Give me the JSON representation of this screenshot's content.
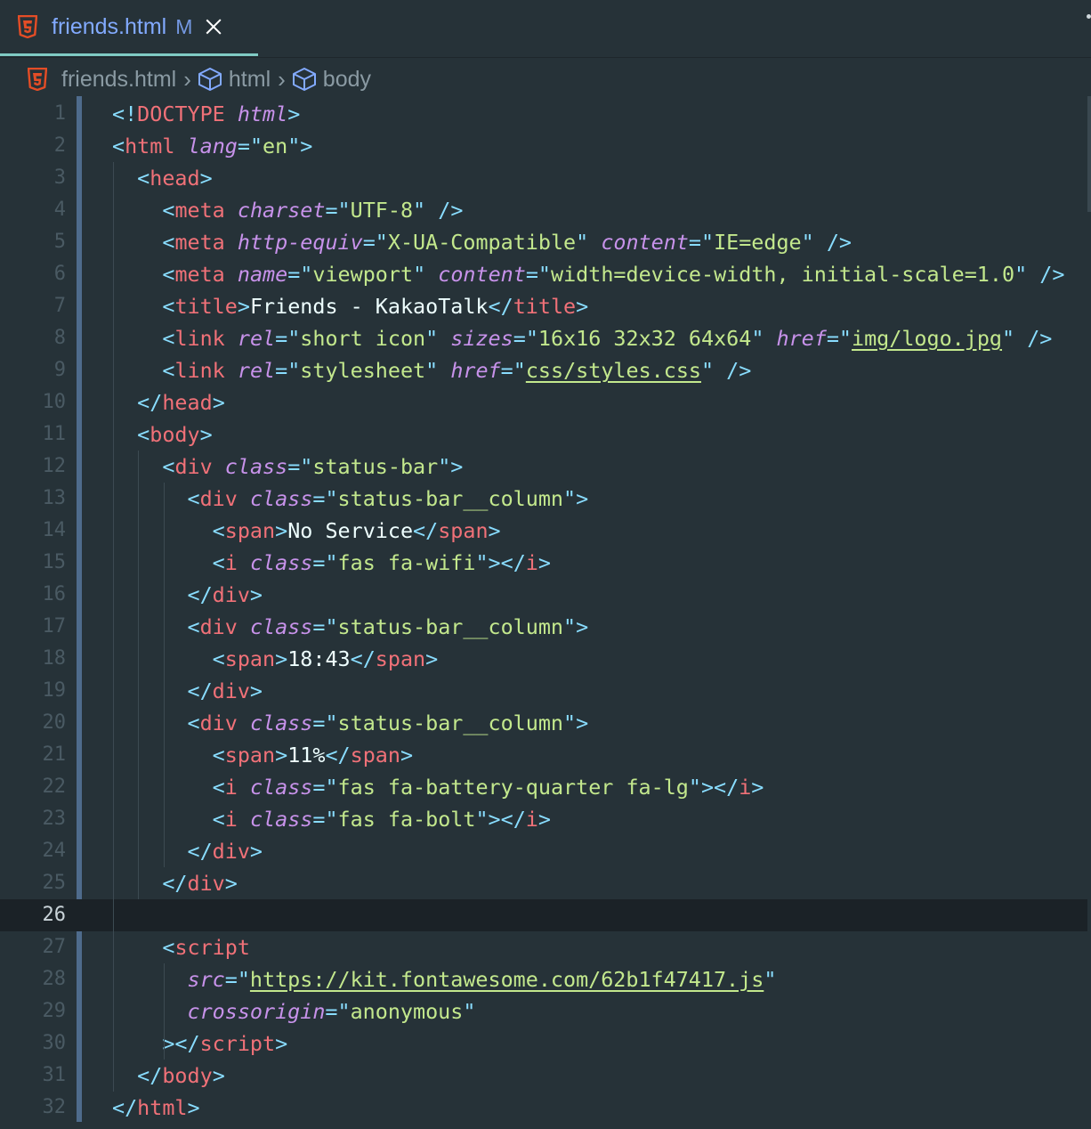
{
  "tab": {
    "file_name": "friends.html",
    "status_badge": "M",
    "icon": "html5-icon"
  },
  "breadcrumb": {
    "items": [
      {
        "label": "friends.html",
        "icon": "html5-icon"
      },
      {
        "label": "html",
        "icon": "cube-icon"
      },
      {
        "label": "body",
        "icon": "cube-icon"
      }
    ],
    "separator": "›"
  },
  "editor": {
    "active_line": 26,
    "lines": [
      {
        "n": "1",
        "tokens": [
          [
            "p",
            "<!"
          ],
          [
            "t",
            "DOCTYPE"
          ],
          [
            "tx",
            " "
          ],
          [
            "a",
            "html"
          ],
          [
            "p",
            ">"
          ]
        ]
      },
      {
        "n": "2",
        "tokens": [
          [
            "p",
            "<"
          ],
          [
            "t",
            "html"
          ],
          [
            "tx",
            " "
          ],
          [
            "a",
            "lang"
          ],
          [
            "p",
            "=\""
          ],
          [
            "s",
            "en"
          ],
          [
            "p",
            "\">"
          ]
        ]
      },
      {
        "n": "3",
        "tokens": [
          [
            "tx",
            "  "
          ],
          [
            "p",
            "<"
          ],
          [
            "t",
            "head"
          ],
          [
            "p",
            ">"
          ]
        ]
      },
      {
        "n": "4",
        "tokens": [
          [
            "tx",
            "    "
          ],
          [
            "p",
            "<"
          ],
          [
            "t",
            "meta"
          ],
          [
            "tx",
            " "
          ],
          [
            "a",
            "charset"
          ],
          [
            "p",
            "=\""
          ],
          [
            "s",
            "UTF-8"
          ],
          [
            "p",
            "\""
          ],
          [
            "tx",
            " "
          ],
          [
            "p",
            "/>"
          ]
        ]
      },
      {
        "n": "5",
        "tokens": [
          [
            "tx",
            "    "
          ],
          [
            "p",
            "<"
          ],
          [
            "t",
            "meta"
          ],
          [
            "tx",
            " "
          ],
          [
            "a",
            "http-equiv"
          ],
          [
            "p",
            "=\""
          ],
          [
            "s",
            "X-UA-Compatible"
          ],
          [
            "p",
            "\""
          ],
          [
            "tx",
            " "
          ],
          [
            "a",
            "content"
          ],
          [
            "p",
            "=\""
          ],
          [
            "s",
            "IE=edge"
          ],
          [
            "p",
            "\""
          ],
          [
            "tx",
            " "
          ],
          [
            "p",
            "/>"
          ]
        ]
      },
      {
        "n": "6",
        "tokens": [
          [
            "tx",
            "    "
          ],
          [
            "p",
            "<"
          ],
          [
            "t",
            "meta"
          ],
          [
            "tx",
            " "
          ],
          [
            "a",
            "name"
          ],
          [
            "p",
            "=\""
          ],
          [
            "s",
            "viewport"
          ],
          [
            "p",
            "\""
          ],
          [
            "tx",
            " "
          ],
          [
            "a",
            "content"
          ],
          [
            "p",
            "=\""
          ],
          [
            "s",
            "width=device-width, initial-scale=1.0"
          ],
          [
            "p",
            "\""
          ],
          [
            "tx",
            " "
          ],
          [
            "p",
            "/>"
          ]
        ]
      },
      {
        "n": "7",
        "tokens": [
          [
            "tx",
            "    "
          ],
          [
            "p",
            "<"
          ],
          [
            "t",
            "title"
          ],
          [
            "p",
            ">"
          ],
          [
            "tx",
            "Friends - KakaoTalk"
          ],
          [
            "p",
            "</"
          ],
          [
            "t",
            "title"
          ],
          [
            "p",
            ">"
          ]
        ]
      },
      {
        "n": "8",
        "tokens": [
          [
            "tx",
            "    "
          ],
          [
            "p",
            "<"
          ],
          [
            "t",
            "link"
          ],
          [
            "tx",
            " "
          ],
          [
            "a",
            "rel"
          ],
          [
            "p",
            "=\""
          ],
          [
            "s",
            "short icon"
          ],
          [
            "p",
            "\""
          ],
          [
            "tx",
            " "
          ],
          [
            "a",
            "sizes"
          ],
          [
            "p",
            "=\""
          ],
          [
            "s",
            "16x16 32x32 64x64"
          ],
          [
            "p",
            "\""
          ],
          [
            "tx",
            " "
          ],
          [
            "a",
            "href"
          ],
          [
            "p",
            "=\""
          ],
          [
            "su",
            "img/logo.jpg"
          ],
          [
            "p",
            "\""
          ],
          [
            "tx",
            " "
          ],
          [
            "p",
            "/>"
          ]
        ]
      },
      {
        "n": "9",
        "tokens": [
          [
            "tx",
            "    "
          ],
          [
            "p",
            "<"
          ],
          [
            "t",
            "link"
          ],
          [
            "tx",
            " "
          ],
          [
            "a",
            "rel"
          ],
          [
            "p",
            "=\""
          ],
          [
            "s",
            "stylesheet"
          ],
          [
            "p",
            "\""
          ],
          [
            "tx",
            " "
          ],
          [
            "a",
            "href"
          ],
          [
            "p",
            "=\""
          ],
          [
            "su",
            "css/styles.css"
          ],
          [
            "p",
            "\""
          ],
          [
            "tx",
            " "
          ],
          [
            "p",
            "/>"
          ]
        ]
      },
      {
        "n": "10",
        "tokens": [
          [
            "tx",
            "  "
          ],
          [
            "p",
            "</"
          ],
          [
            "t",
            "head"
          ],
          [
            "p",
            ">"
          ]
        ]
      },
      {
        "n": "11",
        "tokens": [
          [
            "tx",
            "  "
          ],
          [
            "p",
            "<"
          ],
          [
            "t",
            "body"
          ],
          [
            "p",
            ">"
          ]
        ]
      },
      {
        "n": "12",
        "tokens": [
          [
            "tx",
            "    "
          ],
          [
            "p",
            "<"
          ],
          [
            "t",
            "div"
          ],
          [
            "tx",
            " "
          ],
          [
            "a",
            "class"
          ],
          [
            "p",
            "=\""
          ],
          [
            "s",
            "status-bar"
          ],
          [
            "p",
            "\">"
          ]
        ]
      },
      {
        "n": "13",
        "tokens": [
          [
            "tx",
            "      "
          ],
          [
            "p",
            "<"
          ],
          [
            "t",
            "div"
          ],
          [
            "tx",
            " "
          ],
          [
            "a",
            "class"
          ],
          [
            "p",
            "=\""
          ],
          [
            "s",
            "status-bar__column"
          ],
          [
            "p",
            "\">"
          ]
        ]
      },
      {
        "n": "14",
        "tokens": [
          [
            "tx",
            "        "
          ],
          [
            "p",
            "<"
          ],
          [
            "t",
            "span"
          ],
          [
            "p",
            ">"
          ],
          [
            "tx",
            "No Service"
          ],
          [
            "p",
            "</"
          ],
          [
            "t",
            "span"
          ],
          [
            "p",
            ">"
          ]
        ]
      },
      {
        "n": "15",
        "tokens": [
          [
            "tx",
            "        "
          ],
          [
            "p",
            "<"
          ],
          [
            "t",
            "i"
          ],
          [
            "tx",
            " "
          ],
          [
            "a",
            "class"
          ],
          [
            "p",
            "=\""
          ],
          [
            "s",
            "fas fa-wifi"
          ],
          [
            "p",
            "\"></"
          ],
          [
            "t",
            "i"
          ],
          [
            "p",
            ">"
          ]
        ]
      },
      {
        "n": "16",
        "tokens": [
          [
            "tx",
            "      "
          ],
          [
            "p",
            "</"
          ],
          [
            "t",
            "div"
          ],
          [
            "p",
            ">"
          ]
        ]
      },
      {
        "n": "17",
        "tokens": [
          [
            "tx",
            "      "
          ],
          [
            "p",
            "<"
          ],
          [
            "t",
            "div"
          ],
          [
            "tx",
            " "
          ],
          [
            "a",
            "class"
          ],
          [
            "p",
            "=\""
          ],
          [
            "s",
            "status-bar__column"
          ],
          [
            "p",
            "\">"
          ]
        ]
      },
      {
        "n": "18",
        "tokens": [
          [
            "tx",
            "        "
          ],
          [
            "p",
            "<"
          ],
          [
            "t",
            "span"
          ],
          [
            "p",
            ">"
          ],
          [
            "tx",
            "18:43"
          ],
          [
            "p",
            "</"
          ],
          [
            "t",
            "span"
          ],
          [
            "p",
            ">"
          ]
        ]
      },
      {
        "n": "19",
        "tokens": [
          [
            "tx",
            "      "
          ],
          [
            "p",
            "</"
          ],
          [
            "t",
            "div"
          ],
          [
            "p",
            ">"
          ]
        ]
      },
      {
        "n": "20",
        "tokens": [
          [
            "tx",
            "      "
          ],
          [
            "p",
            "<"
          ],
          [
            "t",
            "div"
          ],
          [
            "tx",
            " "
          ],
          [
            "a",
            "class"
          ],
          [
            "p",
            "=\""
          ],
          [
            "s",
            "status-bar__column"
          ],
          [
            "p",
            "\">"
          ]
        ]
      },
      {
        "n": "21",
        "tokens": [
          [
            "tx",
            "        "
          ],
          [
            "p",
            "<"
          ],
          [
            "t",
            "span"
          ],
          [
            "p",
            ">"
          ],
          [
            "tx",
            "11%"
          ],
          [
            "p",
            "</"
          ],
          [
            "t",
            "span"
          ],
          [
            "p",
            ">"
          ]
        ]
      },
      {
        "n": "22",
        "tokens": [
          [
            "tx",
            "        "
          ],
          [
            "p",
            "<"
          ],
          [
            "t",
            "i"
          ],
          [
            "tx",
            " "
          ],
          [
            "a",
            "class"
          ],
          [
            "p",
            "=\""
          ],
          [
            "s",
            "fas fa-battery-quarter fa-lg"
          ],
          [
            "p",
            "\"></"
          ],
          [
            "t",
            "i"
          ],
          [
            "p",
            ">"
          ]
        ]
      },
      {
        "n": "23",
        "tokens": [
          [
            "tx",
            "        "
          ],
          [
            "p",
            "<"
          ],
          [
            "t",
            "i"
          ],
          [
            "tx",
            " "
          ],
          [
            "a",
            "class"
          ],
          [
            "p",
            "=\""
          ],
          [
            "s",
            "fas fa-bolt"
          ],
          [
            "p",
            "\"></"
          ],
          [
            "t",
            "i"
          ],
          [
            "p",
            ">"
          ]
        ]
      },
      {
        "n": "24",
        "tokens": [
          [
            "tx",
            "      "
          ],
          [
            "p",
            "</"
          ],
          [
            "t",
            "div"
          ],
          [
            "p",
            ">"
          ]
        ]
      },
      {
        "n": "25",
        "tokens": [
          [
            "tx",
            "    "
          ],
          [
            "p",
            "</"
          ],
          [
            "t",
            "div"
          ],
          [
            "p",
            ">"
          ]
        ]
      },
      {
        "n": "26",
        "tokens": []
      },
      {
        "n": "27",
        "tokens": [
          [
            "tx",
            "    "
          ],
          [
            "p",
            "<"
          ],
          [
            "t",
            "script"
          ]
        ]
      },
      {
        "n": "28",
        "tokens": [
          [
            "tx",
            "      "
          ],
          [
            "a",
            "src"
          ],
          [
            "p",
            "=\""
          ],
          [
            "su",
            "https://kit.fontawesome.com/62b1f47417.js"
          ],
          [
            "p",
            "\""
          ]
        ]
      },
      {
        "n": "29",
        "tokens": [
          [
            "tx",
            "      "
          ],
          [
            "a",
            "crossorigin"
          ],
          [
            "p",
            "=\""
          ],
          [
            "s",
            "anonymous"
          ],
          [
            "p",
            "\""
          ]
        ]
      },
      {
        "n": "30",
        "tokens": [
          [
            "tx",
            "    "
          ],
          [
            "p",
            "></"
          ],
          [
            "t",
            "script"
          ],
          [
            "p",
            ">"
          ]
        ]
      },
      {
        "n": "31",
        "tokens": [
          [
            "tx",
            "  "
          ],
          [
            "p",
            "</"
          ],
          [
            "t",
            "body"
          ],
          [
            "p",
            ">"
          ]
        ]
      },
      {
        "n": "32",
        "tokens": [
          [
            "p",
            "</"
          ],
          [
            "t",
            "html"
          ],
          [
            "p",
            ">"
          ]
        ]
      }
    ]
  },
  "colors": {
    "background": "#263238",
    "tag": "#f07178",
    "punctuation": "#89ddff",
    "attribute": "#c792ea",
    "string": "#c3e88d",
    "text": "#eeffff",
    "html_icon": "#e44d26",
    "git_modified_bar": "#4e6b8c"
  }
}
